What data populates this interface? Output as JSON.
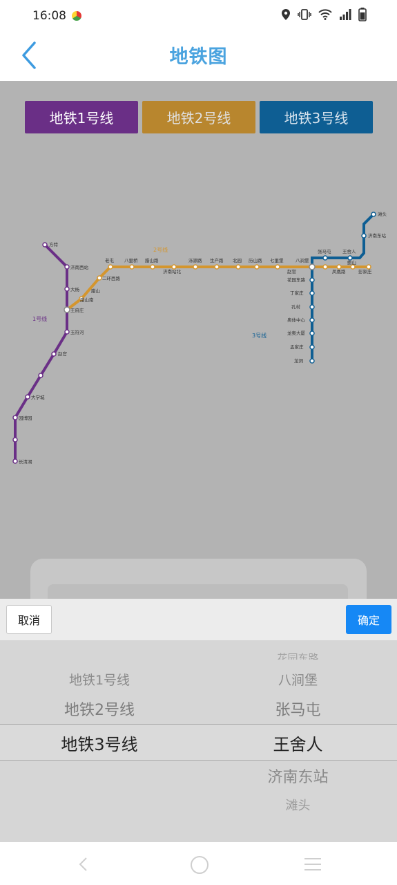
{
  "status_bar": {
    "time": "16:08"
  },
  "header": {
    "title": "地铁图"
  },
  "line_tabs": [
    {
      "label": "地铁1号线",
      "color": "#6a2f86"
    },
    {
      "label": "地铁2号线",
      "color": "#b8862e"
    },
    {
      "label": "地铁3号线",
      "color": "#0e5e93"
    }
  ],
  "map": {
    "line1": {
      "name": "1号线",
      "color": "#6a2f86",
      "stations": [
        "方特",
        "济南西站",
        "大杨",
        "玉符河",
        "王府庄",
        "大学城",
        "园博园",
        "长清湖"
      ]
    },
    "line2": {
      "name": "2号线",
      "color": "#d4962e",
      "stations": [
        "王府庄",
        "二环西路",
        "老屯",
        "八里桥",
        "腊山路",
        "济南站北",
        "泺源路",
        "生产路",
        "北园",
        "历山路",
        "七里堡",
        "八涧堡",
        "张马屯",
        "鲍山",
        "凤凰路",
        "彭家庄"
      ]
    },
    "line3": {
      "name": "3号线",
      "color": "#0e5e93",
      "stations": [
        "滩头",
        "济南东站",
        "王舍人",
        "张马屯",
        "八涧堡",
        "花园东路",
        "丁家庄",
        "孔村",
        "奥体中心",
        "龙奥大厦",
        "孟家庄",
        "龙洞"
      ]
    },
    "extra_labels": [
      "腊山",
      "腊山南",
      "赵官",
      "彭家庄"
    ]
  },
  "picker": {
    "cancel_label": "取消",
    "confirm_label": "确定",
    "lines": [
      "地铁1号线",
      "地铁2号线",
      "地铁3号线"
    ],
    "stations": [
      "花园东路",
      "八涧堡",
      "张马屯",
      "王舍人",
      "济南东站",
      "滩头"
    ],
    "selected_line": "地铁3号线",
    "selected_station": "王舍人"
  }
}
